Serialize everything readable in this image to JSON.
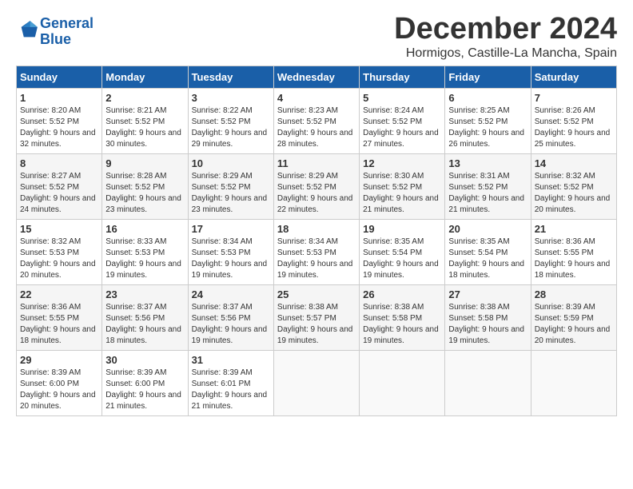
{
  "header": {
    "logo_line1": "General",
    "logo_line2": "Blue",
    "month": "December 2024",
    "location": "Hormigos, Castille-La Mancha, Spain"
  },
  "days_of_week": [
    "Sunday",
    "Monday",
    "Tuesday",
    "Wednesday",
    "Thursday",
    "Friday",
    "Saturday"
  ],
  "weeks": [
    [
      {
        "day": 1,
        "data": "Sunrise: 8:20 AM\nSunset: 5:52 PM\nDaylight: 9 hours and 32 minutes."
      },
      {
        "day": 2,
        "data": "Sunrise: 8:21 AM\nSunset: 5:52 PM\nDaylight: 9 hours and 30 minutes."
      },
      {
        "day": 3,
        "data": "Sunrise: 8:22 AM\nSunset: 5:52 PM\nDaylight: 9 hours and 29 minutes."
      },
      {
        "day": 4,
        "data": "Sunrise: 8:23 AM\nSunset: 5:52 PM\nDaylight: 9 hours and 28 minutes."
      },
      {
        "day": 5,
        "data": "Sunrise: 8:24 AM\nSunset: 5:52 PM\nDaylight: 9 hours and 27 minutes."
      },
      {
        "day": 6,
        "data": "Sunrise: 8:25 AM\nSunset: 5:52 PM\nDaylight: 9 hours and 26 minutes."
      },
      {
        "day": 7,
        "data": "Sunrise: 8:26 AM\nSunset: 5:52 PM\nDaylight: 9 hours and 25 minutes."
      }
    ],
    [
      {
        "day": 8,
        "data": "Sunrise: 8:27 AM\nSunset: 5:52 PM\nDaylight: 9 hours and 24 minutes."
      },
      {
        "day": 9,
        "data": "Sunrise: 8:28 AM\nSunset: 5:52 PM\nDaylight: 9 hours and 23 minutes."
      },
      {
        "day": 10,
        "data": "Sunrise: 8:29 AM\nSunset: 5:52 PM\nDaylight: 9 hours and 23 minutes."
      },
      {
        "day": 11,
        "data": "Sunrise: 8:29 AM\nSunset: 5:52 PM\nDaylight: 9 hours and 22 minutes."
      },
      {
        "day": 12,
        "data": "Sunrise: 8:30 AM\nSunset: 5:52 PM\nDaylight: 9 hours and 21 minutes."
      },
      {
        "day": 13,
        "data": "Sunrise: 8:31 AM\nSunset: 5:52 PM\nDaylight: 9 hours and 21 minutes."
      },
      {
        "day": 14,
        "data": "Sunrise: 8:32 AM\nSunset: 5:52 PM\nDaylight: 9 hours and 20 minutes."
      }
    ],
    [
      {
        "day": 15,
        "data": "Sunrise: 8:32 AM\nSunset: 5:53 PM\nDaylight: 9 hours and 20 minutes."
      },
      {
        "day": 16,
        "data": "Sunrise: 8:33 AM\nSunset: 5:53 PM\nDaylight: 9 hours and 19 minutes."
      },
      {
        "day": 17,
        "data": "Sunrise: 8:34 AM\nSunset: 5:53 PM\nDaylight: 9 hours and 19 minutes."
      },
      {
        "day": 18,
        "data": "Sunrise: 8:34 AM\nSunset: 5:53 PM\nDaylight: 9 hours and 19 minutes."
      },
      {
        "day": 19,
        "data": "Sunrise: 8:35 AM\nSunset: 5:54 PM\nDaylight: 9 hours and 19 minutes."
      },
      {
        "day": 20,
        "data": "Sunrise: 8:35 AM\nSunset: 5:54 PM\nDaylight: 9 hours and 18 minutes."
      },
      {
        "day": 21,
        "data": "Sunrise: 8:36 AM\nSunset: 5:55 PM\nDaylight: 9 hours and 18 minutes."
      }
    ],
    [
      {
        "day": 22,
        "data": "Sunrise: 8:36 AM\nSunset: 5:55 PM\nDaylight: 9 hours and 18 minutes."
      },
      {
        "day": 23,
        "data": "Sunrise: 8:37 AM\nSunset: 5:56 PM\nDaylight: 9 hours and 18 minutes."
      },
      {
        "day": 24,
        "data": "Sunrise: 8:37 AM\nSunset: 5:56 PM\nDaylight: 9 hours and 19 minutes."
      },
      {
        "day": 25,
        "data": "Sunrise: 8:38 AM\nSunset: 5:57 PM\nDaylight: 9 hours and 19 minutes."
      },
      {
        "day": 26,
        "data": "Sunrise: 8:38 AM\nSunset: 5:58 PM\nDaylight: 9 hours and 19 minutes."
      },
      {
        "day": 27,
        "data": "Sunrise: 8:38 AM\nSunset: 5:58 PM\nDaylight: 9 hours and 19 minutes."
      },
      {
        "day": 28,
        "data": "Sunrise: 8:39 AM\nSunset: 5:59 PM\nDaylight: 9 hours and 20 minutes."
      }
    ],
    [
      {
        "day": 29,
        "data": "Sunrise: 8:39 AM\nSunset: 6:00 PM\nDaylight: 9 hours and 20 minutes."
      },
      {
        "day": 30,
        "data": "Sunrise: 8:39 AM\nSunset: 6:00 PM\nDaylight: 9 hours and 21 minutes."
      },
      {
        "day": 31,
        "data": "Sunrise: 8:39 AM\nSunset: 6:01 PM\nDaylight: 9 hours and 21 minutes."
      },
      null,
      null,
      null,
      null
    ]
  ]
}
